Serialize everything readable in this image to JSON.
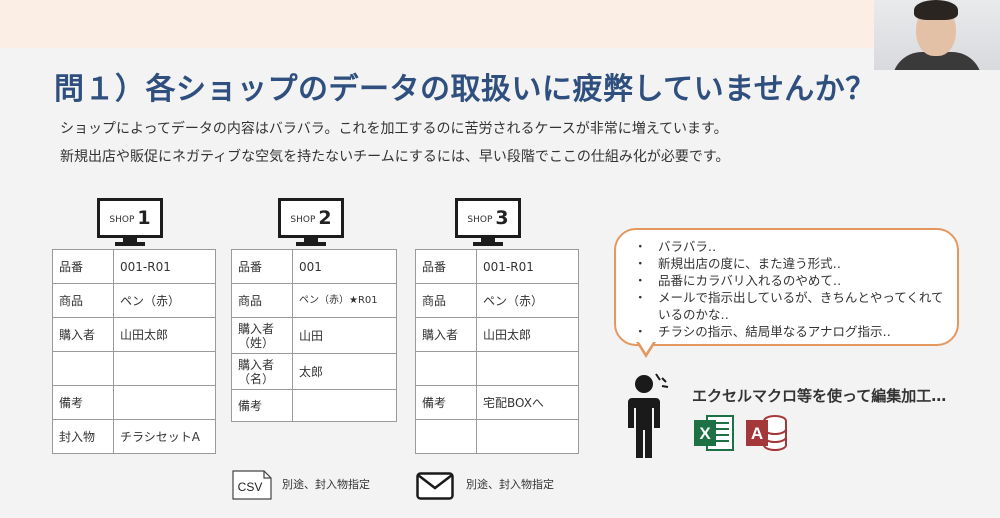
{
  "slide": {
    "title": "問１）各ショップのデータの取扱いに疲弊していませんか？",
    "subtitle_1": "ショップによってデータの内容はバラバラ。これを加工するのに苦労されるケースが非常に増えています。",
    "subtitle_2": "新規出店や販促にネガティブな空気を持たないチームにするには、早い段階でここの仕組み化が必要です。"
  },
  "shops": [
    {
      "label": "SHOP",
      "number": "1",
      "rows": [
        {
          "key": "品番",
          "value": "001-R01"
        },
        {
          "key": "商品",
          "value": "ペン（赤）"
        },
        {
          "key": "購入者",
          "value": "山田太郎"
        },
        {
          "key": "",
          "value": ""
        },
        {
          "key": "備考",
          "value": ""
        },
        {
          "key": "封入物",
          "value": "チラシセットA"
        }
      ]
    },
    {
      "label": "SHOP",
      "number": "2",
      "rows": [
        {
          "key": "品番",
          "value": "001"
        },
        {
          "key": "商品",
          "value": "ペン（赤）★R01"
        },
        {
          "key": "購入者（姓）",
          "key_line1": "購入者",
          "key_line2": "（姓）",
          "value": "山田"
        },
        {
          "key": "購入者（名）",
          "key_line1": "購入者",
          "key_line2": "（名）",
          "value": "太郎"
        },
        {
          "key": "備考",
          "value": ""
        }
      ]
    },
    {
      "label": "SHOP",
      "number": "3",
      "rows": [
        {
          "key": "品番",
          "value": "001-R01"
        },
        {
          "key": "商品",
          "value": "ペン（赤）"
        },
        {
          "key": "購入者",
          "value": "山田太郎"
        },
        {
          "key": "",
          "value": ""
        },
        {
          "key": "備考",
          "value": "宅配BOXへ"
        },
        {
          "key": "",
          "value": ""
        }
      ]
    }
  ],
  "bubble": {
    "bullet": "・",
    "items": [
      "バラバラ‥",
      "新規出店の度に、また違う形式‥",
      "品番にカラバリ入れるのやめて‥",
      "メールで指示出しているが、きちんとやってくれているのかな‥",
      "チラシの指示、結局単なるアナログ指示‥"
    ]
  },
  "excel": {
    "caption": "エクセルマクロ等を使って編集加工…",
    "excel_letter": "X",
    "access_letter": "A"
  },
  "footer": {
    "csv_text": "CSV",
    "csv_label": "別途、封入物指定",
    "mail_label": "別途、封入物指定"
  },
  "icons": {
    "monitor": "monitor-icon",
    "person": "confused-person-icon",
    "excel": "excel-icon",
    "access": "access-icon",
    "csv": "csv-file-icon",
    "mail": "envelope-icon"
  },
  "colors": {
    "title": "#2f4f7f",
    "bubble_border": "#e59760",
    "top_band": "#fbeee4",
    "excel_green": "#1e7145",
    "access_red": "#a4373a"
  }
}
